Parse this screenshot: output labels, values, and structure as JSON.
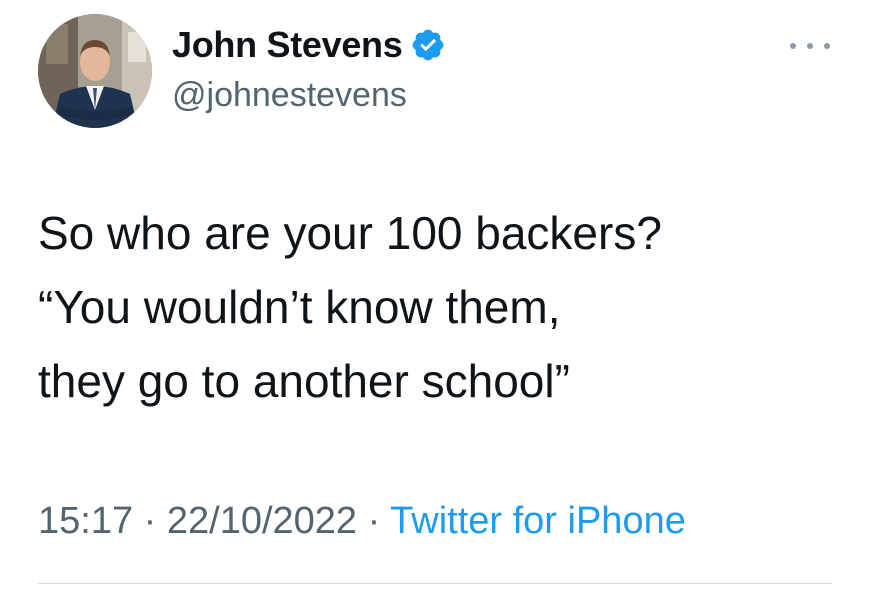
{
  "author": {
    "display_name": "John Stevens",
    "handle": "@johnestevens",
    "verified": true,
    "verified_icon": "verified-badge-icon",
    "verified_color": "#1d9bf0"
  },
  "more_icon": "more-options-icon",
  "tweet": {
    "lines": [
      "So who are your 100 backers?",
      "“You wouldn’t know them,",
      "they go to another school”"
    ]
  },
  "meta": {
    "time": "15:17",
    "separator": " · ",
    "date": "22/10/2022",
    "source": "Twitter for iPhone",
    "source_color": "#1d9bf0"
  }
}
